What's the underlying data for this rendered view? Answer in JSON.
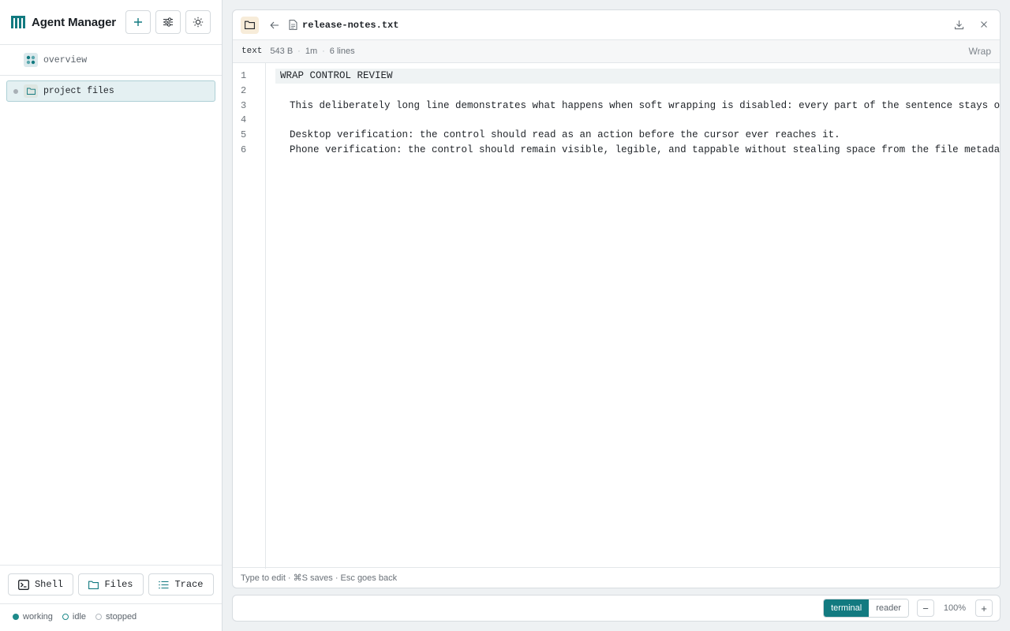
{
  "app": {
    "title": "Agent Manager"
  },
  "sidebar": {
    "overview_label": "overview",
    "project_label": "project files",
    "tools": [
      {
        "label": "Shell",
        "icon": "terminal-icon"
      },
      {
        "label": "Files",
        "icon": "folder-icon"
      },
      {
        "label": "Trace",
        "icon": "list-icon"
      }
    ],
    "legend": [
      {
        "label": "working",
        "color": "#1e8a8a"
      },
      {
        "label": "idle",
        "color": "#1e8a8a"
      },
      {
        "label": "stopped",
        "color": "#b5bbc0"
      }
    ]
  },
  "file": {
    "name": "release-notes.txt",
    "type": "text",
    "size": "543 B",
    "age": "1m",
    "lines_count": "6 lines",
    "wrap_label": "Wrap",
    "lines": [
      "WRAP CONTROL REVIEW",
      "",
      "This deliberately long line demonstrates what happens when soft wrapping is disabled: every part of the sentence stays on",
      "",
      "Desktop verification: the control should read as an action before the cursor ever reaches it.",
      "Phone verification: the control should remain visible, legible, and tappable without stealing space from the file metadata"
    ],
    "line_numbers": [
      "1",
      "2",
      "3",
      "4",
      "5",
      "6"
    ],
    "footer_hint": "Type to edit · ⌘S saves · Esc goes back"
  },
  "bottom_bar": {
    "modes": [
      "terminal",
      "reader"
    ],
    "active_mode": "terminal",
    "zoom_minus": "−",
    "zoom_level": "100%",
    "zoom_plus": "+"
  },
  "colors": {
    "accent": "#127a80",
    "folder_chip": "#f7ecd9",
    "selection": "#e4f0f2"
  }
}
